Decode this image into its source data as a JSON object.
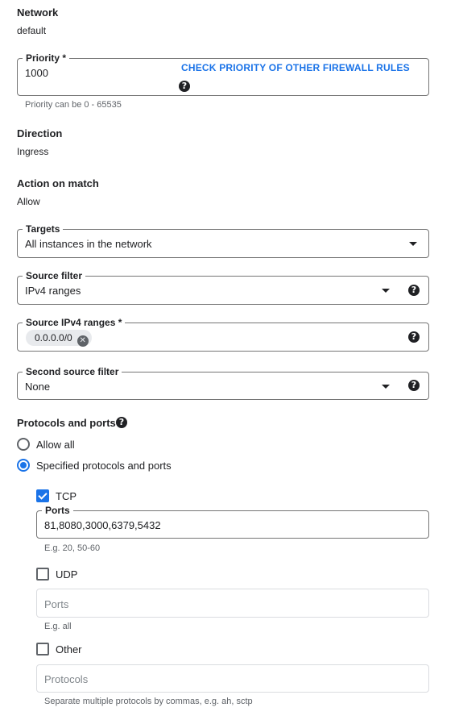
{
  "network": {
    "label": "Network",
    "value": "default"
  },
  "priority": {
    "label": "Priority *",
    "value": "1000",
    "link": "CHECK PRIORITY OF OTHER FIREWALL RULES",
    "hint": "Priority can be 0 - 65535"
  },
  "direction": {
    "label": "Direction",
    "value": "Ingress"
  },
  "action": {
    "label": "Action on match",
    "value": "Allow"
  },
  "targets": {
    "label": "Targets",
    "value": "All instances in the network"
  },
  "source_filter": {
    "label": "Source filter",
    "value": "IPv4 ranges"
  },
  "source_ranges": {
    "label": "Source IPv4 ranges *",
    "chips": [
      "0.0.0.0/0"
    ]
  },
  "second_source_filter": {
    "label": "Second source filter",
    "value": "None"
  },
  "protocols": {
    "label": "Protocols and ports",
    "allow_all": {
      "label": "Allow all",
      "selected": false
    },
    "specified": {
      "label": "Specified protocols and ports",
      "selected": true
    },
    "tcp": {
      "label": "TCP",
      "checked": true,
      "ports_label": "Ports",
      "ports_value": "81,8080,3000,6379,5432",
      "hint": "E.g. 20, 50-60"
    },
    "udp": {
      "label": "UDP",
      "checked": false,
      "ports_placeholder": "Ports",
      "hint": "E.g. all"
    },
    "other": {
      "label": "Other",
      "checked": false,
      "placeholder": "Protocols",
      "hint": "Separate multiple protocols by commas, e.g. ah, sctp"
    }
  },
  "icons": {
    "help": "help-icon",
    "dropdown": "chevron-down-icon",
    "remove": "close-icon"
  },
  "colors": {
    "accent": "#1a73e8",
    "text": "#202124",
    "hint": "#5f6368"
  }
}
